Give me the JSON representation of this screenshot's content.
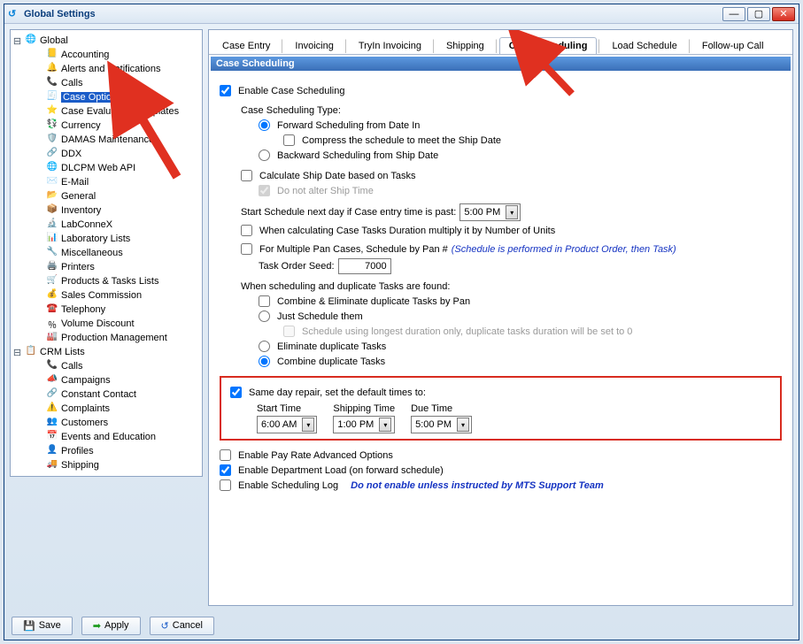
{
  "window": {
    "title": "Global Settings"
  },
  "tree": {
    "roots": [
      {
        "expander": "⊟",
        "icon": "🌐",
        "label": "Global"
      },
      {
        "expander": "⊟",
        "icon": "📋",
        "label": "CRM Lists"
      }
    ],
    "global_items": [
      {
        "icon": "📒",
        "label": "Accounting"
      },
      {
        "icon": "🔔",
        "label": "Alerts and Notifications"
      },
      {
        "icon": "📞",
        "label": "Calls"
      },
      {
        "icon": "🧾",
        "label": "Case Options",
        "selected": true
      },
      {
        "icon": "⭐",
        "label": "Case Evaluation Templates"
      },
      {
        "icon": "💱",
        "label": "Currency"
      },
      {
        "icon": "🛡️",
        "label": "DAMAS Maintenance"
      },
      {
        "icon": "🔗",
        "label": "DDX"
      },
      {
        "icon": "🌐",
        "label": "DLCPM Web API"
      },
      {
        "icon": "✉️",
        "label": "E-Mail"
      },
      {
        "icon": "📂",
        "label": "General"
      },
      {
        "icon": "📦",
        "label": "Inventory"
      },
      {
        "icon": "🔬",
        "label": "LabConneX"
      },
      {
        "icon": "📊",
        "label": "Laboratory Lists"
      },
      {
        "icon": "🔧",
        "label": "Miscellaneous"
      },
      {
        "icon": "🖨️",
        "label": "Printers"
      },
      {
        "icon": "🛒",
        "label": "Products & Tasks Lists"
      },
      {
        "icon": "💰",
        "label": "Sales Commission"
      },
      {
        "icon": "☎️",
        "label": "Telephony"
      },
      {
        "icon": "％",
        "label": "Volume Discount"
      },
      {
        "icon": "🏭",
        "label": "Production Management"
      }
    ],
    "crm_items": [
      {
        "icon": "📞",
        "label": "Calls"
      },
      {
        "icon": "📣",
        "label": "Campaigns"
      },
      {
        "icon": "🔗",
        "label": "Constant Contact"
      },
      {
        "icon": "⚠️",
        "label": "Complaints"
      },
      {
        "icon": "👥",
        "label": "Customers"
      },
      {
        "icon": "📅",
        "label": "Events and Education"
      },
      {
        "icon": "👤",
        "label": "Profiles"
      },
      {
        "icon": "🚚",
        "label": "Shipping"
      }
    ]
  },
  "tabs": [
    {
      "label": "Case Entry"
    },
    {
      "label": "Invoicing"
    },
    {
      "label": "TryIn Invoicing"
    },
    {
      "label": "Shipping"
    },
    {
      "label": "Case Scheduling",
      "active": true
    },
    {
      "label": "Load Schedule"
    },
    {
      "label": "Follow-up Call"
    }
  ],
  "section_title": "Case Scheduling",
  "form": {
    "enable": "Enable Case Scheduling",
    "type_label": "Case Scheduling Type:",
    "forward": "Forward Scheduling from Date In",
    "compress": "Compress the schedule to meet the Ship Date",
    "backward": "Backward Scheduling from Ship Date",
    "calc": "Calculate Ship Date based on Tasks",
    "noalter": "Do not alter Ship Time",
    "next_day": "Start Schedule next day if Case entry time is past:",
    "next_day_val": "5:00 PM",
    "mult_units": "When calculating Case Tasks Duration multiply it by Number of Units",
    "multi_pan": "For Multiple Pan Cases, Schedule by Pan #",
    "multi_pan_note": "(Schedule is performed in Product Order, then Task)",
    "seed_label": "Task Order Seed:",
    "seed_val": "7000",
    "dup_heading": "When scheduling and duplicate Tasks are found:",
    "dup_combine_elim": "Combine & Eliminate duplicate Tasks by Pan",
    "dup_just": "Just Schedule them",
    "dup_longest": "Schedule using longest duration only, duplicate tasks duration will be set to 0",
    "dup_elim": "Eliminate duplicate Tasks",
    "dup_combine": "Combine duplicate Tasks",
    "sameday": "Same day repair, set the default times to:",
    "start_label": "Start Time",
    "shipping_label": "Shipping Time",
    "due_label": "Due Time",
    "start_val": "6:00 AM",
    "shipping_val": "1:00 PM",
    "due_val": "5:00 PM",
    "pay_rate": "Enable Pay Rate Advanced Options",
    "dept_load": "Enable Department Load (on forward schedule)",
    "sched_log": "Enable Scheduling Log",
    "sched_log_note": "Do not enable unless instructed by MTS Support Team"
  },
  "footer": {
    "save": "Save",
    "apply": "Apply",
    "cancel": "Cancel"
  }
}
